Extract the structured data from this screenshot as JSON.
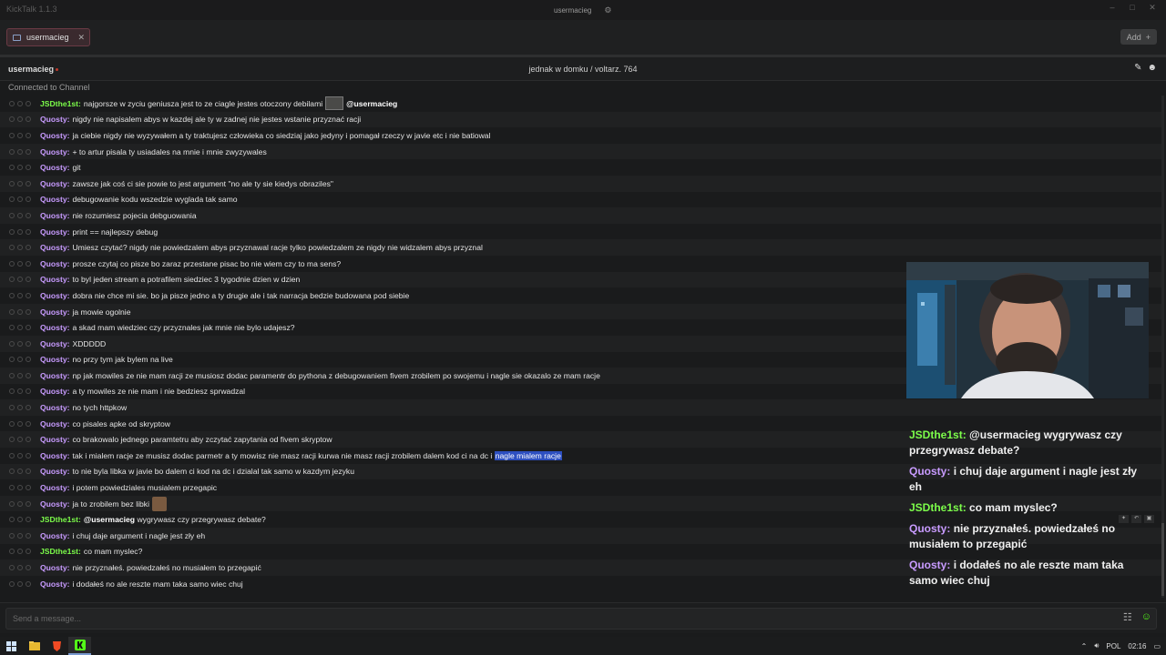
{
  "window": {
    "app_title": "KickTalk 1.1.3",
    "center_user": "usermacieg"
  },
  "tabs": [
    {
      "label": "usermacieg"
    }
  ],
  "tabbar": {
    "add_label": "Add"
  },
  "channel": {
    "name": "usermacieg",
    "stream_title": "jednak w domku / voltarz. 764"
  },
  "status": {
    "connected": "Connected to Channel"
  },
  "messages": [
    {
      "author": "JSDthe1st:",
      "text": "najgorsze w zyciu geniusza jest to ze ciagle jestes otoczony debilami",
      "emote": "a",
      "mention": "@usermacieg"
    },
    {
      "author": "Quοsty:",
      "text": "nigdy nie napisalem abys w kazdej ale ty w zadnej nie jestes wstanie przyznać racji"
    },
    {
      "author": "Quοsty:",
      "text": "ja ciebie nigdy nie wyzywałem a ty traktujesz człowieka co siedziaj jako jedyny i pomagał rzeczy w javie etc i nie batiowal"
    },
    {
      "author": "Quοsty:",
      "text": "+ to artur pisala ty usiadales na mnie i mnie zwyzywales"
    },
    {
      "author": "Quοsty:",
      "text": "git"
    },
    {
      "author": "Quοsty:",
      "text": "zawsze jak coś ci sie powie to jest argument \"no ale ty sie kiedys obraziles\""
    },
    {
      "author": "Quοsty:",
      "text": "debugowanie kodu wszedzie wyglada tak samo"
    },
    {
      "author": "Quοsty:",
      "text": "nie rozumiesz pojecia debguowania"
    },
    {
      "author": "Quοsty:",
      "text": "print == najlepszy debug"
    },
    {
      "author": "Quοsty:",
      "text": "Umiesz czytać? nigdy nie powiedzalem abys przyznawal racje tylko powiedzalem ze nigdy nie widzalem abys przyznal"
    },
    {
      "author": "Quοsty:",
      "text": "prosze czytaj co pisze bo zaraz przestane pisac bo nie wiem czy to ma sens?"
    },
    {
      "author": "Quοsty:",
      "text": "to byl jeden stream a potrafilem siedziec 3 tygodnie dzien w dzien"
    },
    {
      "author": "Quοsty:",
      "text": "dobra nie chce mi sie. bo ja pisze jedno a ty drugie ale i tak narracja bedzie budowana pod siebie"
    },
    {
      "author": "Quοsty:",
      "text": "ja mowie ogolnie"
    },
    {
      "author": "Quοsty:",
      "text": "a skad mam wiedziec czy przyznales jak mnie nie bylo udajesz?"
    },
    {
      "author": "Quοsty:",
      "text": "XDDDDD"
    },
    {
      "author": "Quοsty:",
      "text": "no przy tym jak bylem na live"
    },
    {
      "author": "Quοsty:",
      "text": "np jak mowiles ze nie mam racji ze musiosz dodac paramentr do pythona z debugowaniem fivem zrobilem po swojemu i nagle sie okazalo ze mam racje"
    },
    {
      "author": "Quοsty:",
      "text": "a ty mowiles ze nie mam i nie bedziesz sprwadzal"
    },
    {
      "author": "Quοsty:",
      "text": "no tych httpkow"
    },
    {
      "author": "Quοsty:",
      "text": "co pisales apke od skryptow"
    },
    {
      "author": "Quοsty:",
      "text": "co brakowalo jednego paramtetru aby zczytać zapytania od fivem skryptow"
    },
    {
      "author": "Quοsty:",
      "text": "tak i mialem racje ze musisz dodac parmetr a ty mowisz nie masz racji kurwa nie masz racji zrobilem dalem kod ci na dc i",
      "highlight": "nagle mialem racje"
    },
    {
      "author": "Quοsty:",
      "text": "to nie byla libka w javie bo dalem ci kod na dc i dzialal tak samo w kazdym jezyku"
    },
    {
      "author": "Quοsty:",
      "text": "i potem powiedziales musialem przegapic"
    },
    {
      "author": "Quοsty:",
      "text": "ja to zrobilem bez libki",
      "emote": "b"
    },
    {
      "author": "JSDthe1st:",
      "mention": "@usermacieg",
      "text": "wygrywasz czy przegrywasz debate?"
    },
    {
      "author": "Quοsty:",
      "text": "i chuj daje argument i nagle jest zły eh"
    },
    {
      "author": "JSDthe1st:",
      "text": "co mam myslec?"
    },
    {
      "author": "Quοsty:",
      "text": "nie przyznałeś. powiedzałeś no musiałem to przegapić"
    },
    {
      "author": "Quοsty:",
      "text": "i dodałeś no ale reszte mam taka samo wiec chuj"
    }
  ],
  "input": {
    "placeholder": "Send a message..."
  },
  "overlay": [
    {
      "author": "JSDthe1st:",
      "text": "@usermacieg wygrywasz czy przegrywasz debate?"
    },
    {
      "author": "Quοsty:",
      "text": "i chuj daje argument i nagle jest zły eh"
    },
    {
      "author": "JSDthe1st:",
      "text": "co mam myslec?"
    },
    {
      "author": "Quοsty:",
      "text": "nie przyznałeś. powiedzałeś no musiałem to przegapić"
    },
    {
      "author": "Quοsty:",
      "text": "i dodałeś no ale reszte mam taka samo wiec chuj"
    }
  ],
  "taskbar": {
    "lang": "POL",
    "time": "02:16"
  },
  "colors": {
    "author_jsd": "#7cfc4a",
    "author_questy": "#c89bff",
    "highlight": "#2d4fc0",
    "accent": "#53fc18"
  }
}
